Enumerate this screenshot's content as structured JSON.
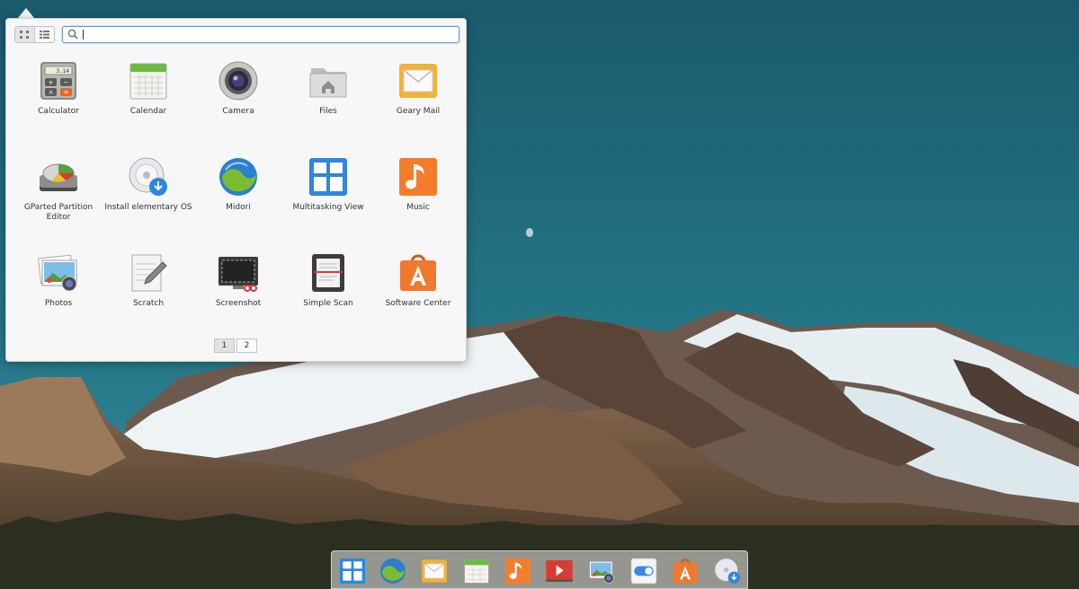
{
  "desktop": {
    "wallpaper": "mountain-landscape",
    "sky_color": "#1f6678"
  },
  "app_menu": {
    "view_modes": [
      {
        "icon": "grid-view-icon",
        "active": true
      },
      {
        "icon": "category-view-icon",
        "active": false
      }
    ],
    "search": {
      "value": "",
      "placeholder": ""
    },
    "apps": [
      {
        "label": "Calculator",
        "icon": "calculator-icon"
      },
      {
        "label": "Calendar",
        "icon": "calendar-icon"
      },
      {
        "label": "Camera",
        "icon": "camera-icon"
      },
      {
        "label": "Files",
        "icon": "files-icon"
      },
      {
        "label": "Geary Mail",
        "icon": "mail-icon"
      },
      {
        "label": "GParted Partition Editor",
        "icon": "gparted-icon"
      },
      {
        "label": "Install elementary OS",
        "icon": "installer-icon"
      },
      {
        "label": "Midori",
        "icon": "midori-icon"
      },
      {
        "label": "Multitasking View",
        "icon": "multitasking-icon"
      },
      {
        "label": "Music",
        "icon": "music-icon"
      },
      {
        "label": "Photos",
        "icon": "photos-icon"
      },
      {
        "label": "Scratch",
        "icon": "scratch-icon"
      },
      {
        "label": "Screenshot",
        "icon": "screenshot-icon"
      },
      {
        "label": "Simple Scan",
        "icon": "scan-icon"
      },
      {
        "label": "Software Center",
        "icon": "software-center-icon"
      }
    ],
    "pages": [
      "1",
      "2"
    ],
    "current_page": "1"
  },
  "dock": {
    "items": [
      {
        "icon": "multitasking-icon"
      },
      {
        "icon": "midori-icon"
      },
      {
        "icon": "mail-icon"
      },
      {
        "icon": "calendar-icon"
      },
      {
        "icon": "music-icon"
      },
      {
        "icon": "videos-icon"
      },
      {
        "icon": "photos-icon"
      },
      {
        "icon": "settings-toggle-icon"
      },
      {
        "icon": "software-center-icon"
      },
      {
        "icon": "installer-icon"
      }
    ]
  },
  "colors": {
    "accent": "#3689e6",
    "search_border": "#6c9bd2",
    "popover_bg": "#f7f7f7"
  }
}
